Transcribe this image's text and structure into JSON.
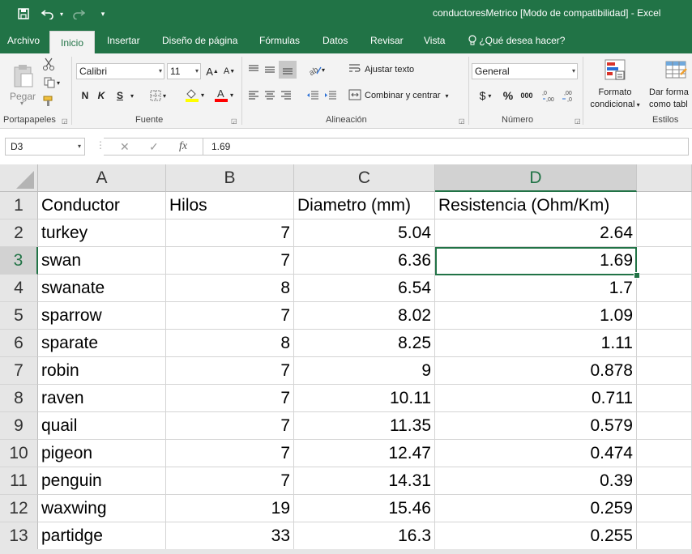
{
  "window": {
    "title": "conductoresMetrico  [Modo de compatibilidad]  -  Excel",
    "quick_access": {
      "save_icon": "save-icon",
      "undo_icon": "undo-icon",
      "redo_icon": "redo-icon",
      "customize_icon": "chevron-down-icon"
    }
  },
  "tabs": [
    "Archivo",
    "Inicio",
    "Insertar",
    "Diseño de página",
    "Fórmulas",
    "Datos",
    "Revisar",
    "Vista"
  ],
  "tell_me": "¿Qué desea hacer?",
  "ribbon": {
    "clipboard": {
      "paste_label": "Pegar",
      "group_label": "Portapapeles"
    },
    "font": {
      "font_name": "Calibri",
      "font_size": "11",
      "bold": "N",
      "italic": "K",
      "underline": "S",
      "group_label": "Fuente"
    },
    "alignment": {
      "wrap_text": "Ajustar texto",
      "merge_center": "Combinar y centrar",
      "group_label": "Alineación"
    },
    "number": {
      "format": "General",
      "currency": "$",
      "percent": "%",
      "thousands": "000",
      "group_label": "Número"
    },
    "styles": {
      "conditional_format_line1": "Formato",
      "conditional_format_line2": "condicional",
      "table_format_line1": "Dar forma",
      "table_format_line2": "como tabl",
      "group_label": "Estilos"
    },
    "colors": {
      "fill_color": "#ffff00",
      "font_color": "#ff0000"
    }
  },
  "formula_bar": {
    "name_box": "D3",
    "fx": "fx",
    "value": "1.69"
  },
  "columns": [
    "A",
    "B",
    "C",
    "D"
  ],
  "rows": [
    {
      "num": "1",
      "cells": [
        "Conductor",
        "Hilos",
        "Diametro (mm)",
        "Resistencia (Ohm/Km)"
      ]
    },
    {
      "num": "2",
      "cells": [
        "turkey",
        "7",
        "5.04",
        "2.64"
      ]
    },
    {
      "num": "3",
      "cells": [
        "swan",
        "7",
        "6.36",
        "1.69"
      ]
    },
    {
      "num": "4",
      "cells": [
        "swanate",
        "8",
        "6.54",
        "1.7"
      ]
    },
    {
      "num": "5",
      "cells": [
        "sparrow",
        "7",
        "8.02",
        "1.09"
      ]
    },
    {
      "num": "6",
      "cells": [
        "sparate",
        "8",
        "8.25",
        "1.11"
      ]
    },
    {
      "num": "7",
      "cells": [
        "robin",
        "7",
        "9",
        "0.878"
      ]
    },
    {
      "num": "8",
      "cells": [
        "raven",
        "7",
        "10.11",
        "0.711"
      ]
    },
    {
      "num": "9",
      "cells": [
        "quail",
        "7",
        "11.35",
        "0.579"
      ]
    },
    {
      "num": "10",
      "cells": [
        "pigeon",
        "7",
        "12.47",
        "0.474"
      ]
    },
    {
      "num": "11",
      "cells": [
        "penguin",
        "7",
        "14.31",
        "0.39"
      ]
    },
    {
      "num": "12",
      "cells": [
        "waxwing",
        "19",
        "15.46",
        "0.259"
      ]
    },
    {
      "num": "13",
      "cells": [
        "partidge",
        "33",
        "16.3",
        "0.255"
      ]
    }
  ],
  "theme": {
    "accent": "#217346"
  }
}
